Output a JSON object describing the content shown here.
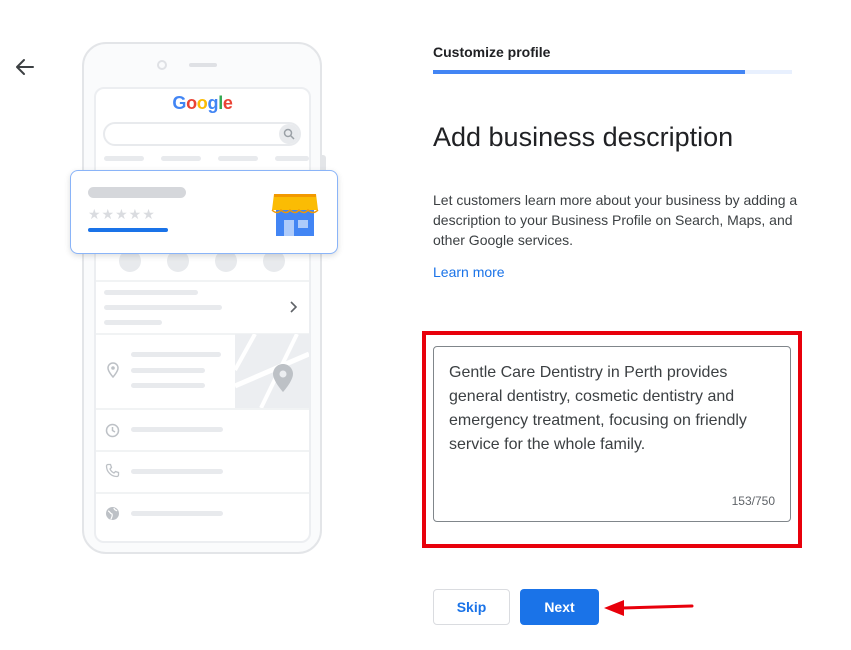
{
  "header": {
    "back_icon": "arrow-left-icon",
    "step_label": "Customize profile",
    "progress_fraction": 0.87
  },
  "illustration": {
    "logo_letters": [
      {
        "char": "G",
        "color": "#4285F4"
      },
      {
        "char": "o",
        "color": "#EA4335"
      },
      {
        "char": "o",
        "color": "#FBBC05"
      },
      {
        "char": "g",
        "color": "#4285F4"
      },
      {
        "char": "l",
        "color": "#34A853"
      },
      {
        "char": "e",
        "color": "#EA4335"
      }
    ],
    "stars": "★★★★★",
    "icons": [
      "search-icon",
      "store-icon",
      "pin-icon",
      "clock-icon",
      "phone-icon",
      "globe-icon"
    ]
  },
  "main": {
    "title": "Add business description",
    "description": "Let customers learn more about your business by adding a description to your Business Profile on Search, Maps, and other Google services.",
    "learn_more": "Learn more",
    "textarea_value": "Gentle Care Dentistry in Perth provides general dentistry, cosmetic dentistry and emergency treatment, focusing on friendly service for the whole family.",
    "char_count": "153/750"
  },
  "buttons": {
    "skip": "Skip",
    "next": "Next"
  },
  "colors": {
    "accent": "#1a73e8",
    "annotation": "#e8000b"
  }
}
